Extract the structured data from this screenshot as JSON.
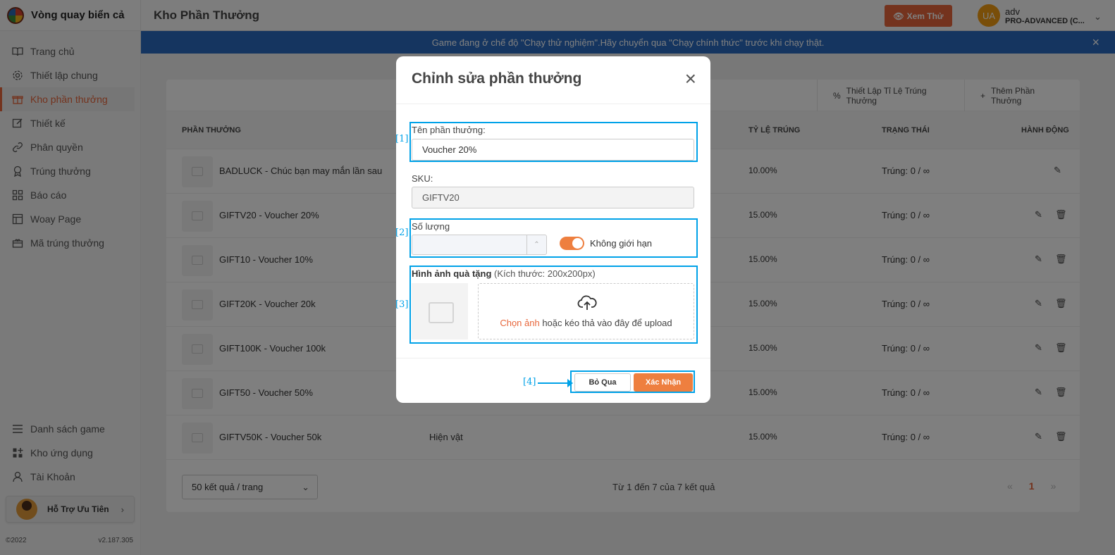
{
  "brand": {
    "name": "Vòng quay biển cả"
  },
  "sidebar": {
    "items": [
      {
        "label": "Trang chủ",
        "icon": "book-icon"
      },
      {
        "label": "Thiết lập chung",
        "icon": "gear-icon"
      },
      {
        "label": "Kho phần thưởng",
        "icon": "gift-icon"
      },
      {
        "label": "Thiết kế",
        "icon": "edit-icon"
      },
      {
        "label": "Phân quyền",
        "icon": "link-icon"
      },
      {
        "label": "Trúng thưởng",
        "icon": "award-icon"
      },
      {
        "label": "Báo cáo",
        "icon": "grid-icon"
      },
      {
        "label": "Woay Page",
        "icon": "layout-icon"
      },
      {
        "label": "Mã trúng thưởng",
        "icon": "ticket-icon"
      }
    ],
    "bottom_items": [
      {
        "label": "Danh sách game",
        "icon": "menu-icon"
      },
      {
        "label": "Kho ứng dụng",
        "icon": "apps-icon"
      },
      {
        "label": "Tài Khoản",
        "icon": "user-icon"
      }
    ],
    "support_label": "Hỗ Trợ Ưu Tiên",
    "copyright": "©2022",
    "version": "v2.187.305"
  },
  "header": {
    "title": "Kho Phần Thưởng",
    "preview_label": "Xem Thử",
    "user_initials": "UA",
    "user_name": "adv",
    "user_plan": "PRO-ADVANCED (C..."
  },
  "banner": {
    "text": "Game đang ở chế độ \"Chạy thử nghiệm\".Hãy chuyển qua \"Chạy chính thức\" trước khi chạy thật.",
    "close": "×"
  },
  "toolbar": {
    "rate_label": "Thiết Lập Tỉ Lệ Trúng Thưởng",
    "add_label": "Thêm Phần Thưởng"
  },
  "table": {
    "headers": {
      "reward": "PHẦN THƯỞNG",
      "rate": "TỶ LỆ TRÚNG",
      "status": "TRẠNG THÁI",
      "action": "HÀNH ĐỘNG"
    },
    "rows": [
      {
        "name": "BADLUCK - Chúc bạn may mắn lần sau",
        "type": "",
        "rate": "10.00%",
        "status": "Trúng: 0 / ∞"
      },
      {
        "name": "GIFTV20 - Voucher 20%",
        "type": "",
        "rate": "15.00%",
        "status": "Trúng: 0 / ∞"
      },
      {
        "name": "GIFT10 - Voucher 10%",
        "type": "",
        "rate": "15.00%",
        "status": "Trúng: 0 / ∞"
      },
      {
        "name": "GIFT20K - Voucher 20k",
        "type": "",
        "rate": "15.00%",
        "status": "Trúng: 0 / ∞"
      },
      {
        "name": "GIFT100K - Voucher 100k",
        "type": "",
        "rate": "15.00%",
        "status": "Trúng: 0 / ∞"
      },
      {
        "name": "GIFT50 - Voucher 50%",
        "type": "",
        "rate": "15.00%",
        "status": "Trúng: 0 / ∞"
      },
      {
        "name": "GIFTV50K - Voucher 50k",
        "type": "Hiện vật",
        "rate": "15.00%",
        "status": "Trúng: 0 / ∞"
      }
    ]
  },
  "pagination": {
    "page_size": "50 kết quả / trang",
    "summary": "Từ 1 đến 7 của 7 kết quả",
    "prev": "«",
    "current": "1",
    "next": "»"
  },
  "modal": {
    "title": "Chỉnh sửa phần thưởng",
    "close": "×",
    "name_label": "Tên phần thưởng:",
    "name_value": "Voucher 20%",
    "sku_label": "SKU:",
    "sku_value": "GIFTV20",
    "qty_label": "Số lượng",
    "qty_value": "",
    "unlimited_label": "Không giới hạn",
    "unlimited_on": true,
    "image_label": "Hình ảnh quà tặng",
    "image_hint": "(Kích thước: 200x200px)",
    "upload_pick": "Chọn ảnh",
    "upload_rest": " hoặc kéo thả vào đây để upload",
    "cancel_label": "Bỏ Qua",
    "confirm_label": "Xác Nhận"
  },
  "annotations": [
    "[1]",
    "[2]",
    "[3]",
    "[4]"
  ],
  "colors": {
    "accent": "#e8673c",
    "banner": "#2a6bc0",
    "highlight": "#00a2e8"
  }
}
